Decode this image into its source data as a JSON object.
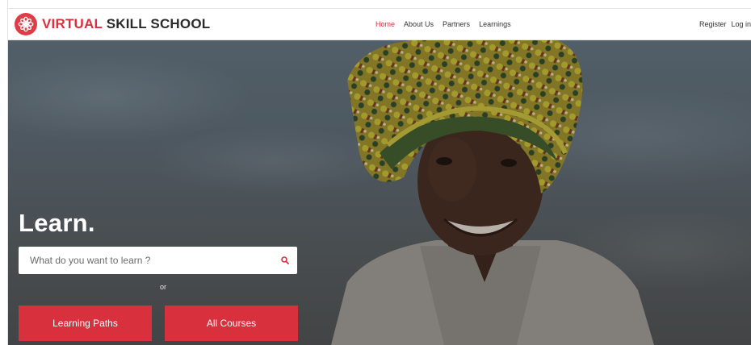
{
  "brand": {
    "name_accent": "VIRTUAL",
    "name_rest": " SKILL SCHOOL",
    "logo_icon": "star-burst-icon",
    "color": "#d9303e"
  },
  "nav": {
    "links": [
      {
        "label": "Home",
        "active": true
      },
      {
        "label": "About Us",
        "active": false
      },
      {
        "label": "Partners",
        "active": false
      },
      {
        "label": "Learnings",
        "active": false
      }
    ],
    "auth": {
      "register": "Register",
      "login": "Log in"
    }
  },
  "hero": {
    "heading": "Learn.",
    "search": {
      "placeholder": "What do you want to learn ?",
      "value": "",
      "icon": "search-icon"
    },
    "or_text": "or",
    "buttons": {
      "learning_paths": "Learning Paths",
      "all_courses": "All Courses"
    }
  },
  "colors": {
    "accent": "#d9303e",
    "navbar_bg": "#ffffff",
    "hero_overlay": "#54595c"
  }
}
